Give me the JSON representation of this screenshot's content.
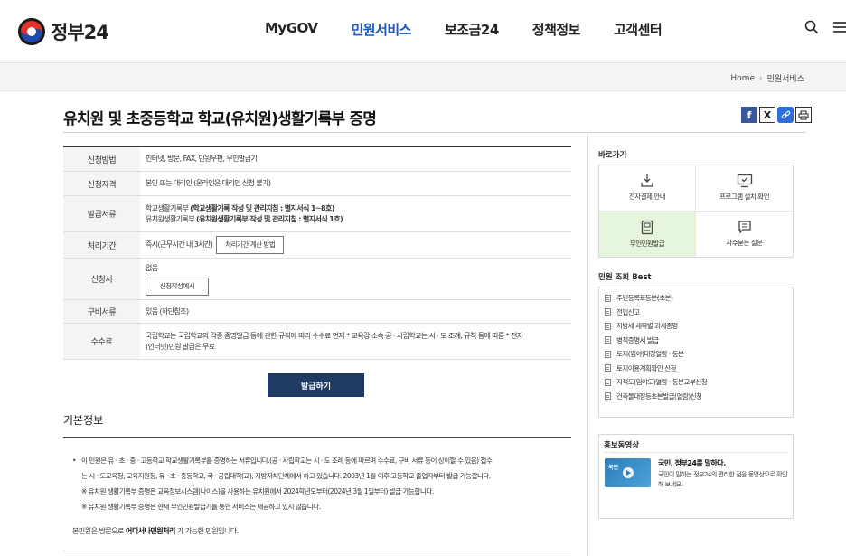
{
  "header": {
    "logo_text": "정부24",
    "menu": [
      {
        "label": "MyGOV",
        "active": false
      },
      {
        "label": "민원서비스",
        "active": true
      },
      {
        "label": "보조금24",
        "active": false
      },
      {
        "label": "정책정보",
        "active": false
      },
      {
        "label": "고객센터",
        "active": false
      }
    ]
  },
  "breadcrumb": [
    "Home",
    "민원서비스"
  ],
  "page": {
    "title": "유치원 및 초중등학교 학교(유치원)생활기록부 증명"
  },
  "info_table": {
    "apply_method": {
      "label": "신청방법",
      "value": "인터넷, 방문, FAX, 민원우편, 무인발급기"
    },
    "qualification": {
      "label": "신청자격",
      "prefix": "본인 또는 대리인 ",
      "bold": "(온라인은 대리인 신청 불가)"
    },
    "documents": {
      "label": "발급서류",
      "line1_prefix": "학교생활기록부 ",
      "line1_bold": "(학교생활기록 작성 및 관리지침 : 별지서식 1~8호)",
      "line2_prefix": "유치원생활기록부 ",
      "line2_bold": "(유치원생활기록부 작성 및 관리지침 : 별지서식 1호)"
    },
    "processing": {
      "label": "처리기간",
      "value": "즉시(근무시간 내 3시간)",
      "button": "처리기간 계산 방법"
    },
    "form": {
      "label": "신청서",
      "value": "없음",
      "button": "신청작성예시"
    },
    "required_docs": {
      "label": "구비서류",
      "value": "있음 (하단참조)"
    },
    "fee": {
      "label": "수수료",
      "line1": "국립학교는 국립학교의 각종 증명발급 등에 관한 규칙에 따라 수수료 면제 * 교육감 소속 공 · 사립학교는 시 · 도 조례, 규칙 등에 따름 * 전자",
      "line2": "(인터넷)민원 발급은 무료"
    }
  },
  "issue_button": "발급하기",
  "basic_info": {
    "title": "기본정보",
    "line1": "이 민원은 유 · 초 · 중 · 고등학교 학교생활기록부를 증명하는 서류입니다.(공 · 사립학교는 시 · 도 조례 등에 따르며 수수료, 구비 서류 등이 상이할 수 있음) 접수",
    "line2": "는 시 · 도교육청, 교육지원청, 유 · 초 · 중등학교, 국 · 공립대학(교), 지방자치단체에서 하고 있습니다. 2003년 1월 이후 고등학교 졸업자부터 발급 가능합니다.",
    "line3": "※ 유치원 생활기록부 증명은 교육정보시스템(나이스)을 사용하는 유치원에서 2024학년도부터(2024년 3월 1일부터) 발급 가능합니다.",
    "line4": "※ 유치원 생활기록부 증명은 현재 무인민원발급기를 통한 서비스는 제공하고 있지 않습니다.",
    "visit_prefix": "본민원은 방문으로 ",
    "visit_bold": "어디서나민원처리",
    "visit_suffix": " 가 가능한 민원입니다."
  },
  "side": {
    "quick_title": "바로가기",
    "quick": [
      {
        "label": "전자결제 안내",
        "icon": "payment-icon",
        "highlight": false
      },
      {
        "label": "프로그램 설치 확인",
        "icon": "monitor-check-icon",
        "highlight": false
      },
      {
        "label": "무인민원발급",
        "icon": "kiosk-icon",
        "highlight": true
      },
      {
        "label": "자주묻는 질문",
        "icon": "faq-icon",
        "highlight": false
      }
    ],
    "best_title": "민원 조회 Best",
    "best": [
      "주민등록표등본(초본)",
      "전입신고",
      "지방세 세목별 과세증명",
      "병적증명서 발급",
      "토지(임야)대장열람 · 등본",
      "토지이용계획확인 신청",
      "지적도(임야도)열람 · 등본교부신청",
      "건축물대장등초본발급(열람)신청"
    ],
    "promo_title": "홍보동영상",
    "promo_headline": "국민, 정부24를 말하다.",
    "promo_desc": "국민이 말하는 정부24의 편리한 점을 동영상으로 확인해 보세요.",
    "promo_thumb_text": "국민"
  }
}
